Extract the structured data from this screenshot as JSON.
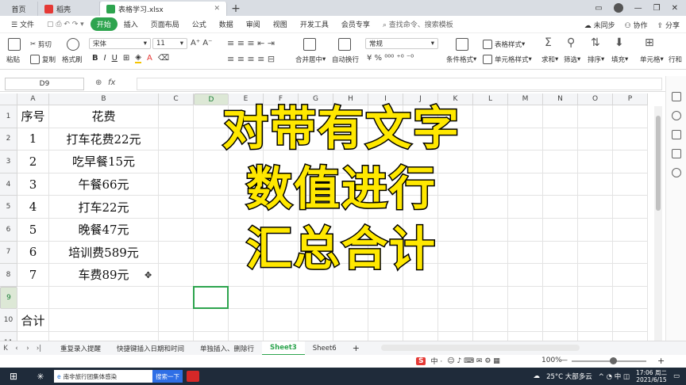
{
  "tabs": {
    "home": "首页",
    "doc": "稻壳",
    "file": "表格学习.xlsx"
  },
  "menubar": {
    "file": "文件",
    "items": [
      "开始",
      "插入",
      "页面布局",
      "公式",
      "数据",
      "审阅",
      "视图",
      "开发工具",
      "会员专享"
    ],
    "search": "查找命令、搜索模板",
    "unsynced": "未同步",
    "collab": "协作",
    "share": "分享"
  },
  "ribbon": {
    "paste": "粘贴",
    "cut": "剪切",
    "copy": "复制",
    "format_painter": "格式刷",
    "font": "宋体",
    "size": "11",
    "number_format": "常规",
    "merge": "合并居中",
    "wrap": "自动换行",
    "cond_format": "条件格式",
    "table_style": "表格样式",
    "cell_style": "单元格样式",
    "sum": "求和",
    "filter": "筛选",
    "sort": "排序",
    "fill": "填充",
    "cell": "单元格",
    "rowcol": "行和"
  },
  "formula_bar": {
    "cell_ref": "D9",
    "fx": "fx",
    "value": ""
  },
  "columns": [
    "A",
    "B",
    "C",
    "D",
    "E",
    "F",
    "G",
    "H",
    "I",
    "J",
    "K",
    "L",
    "M",
    "N",
    "O",
    "P"
  ],
  "rows": [
    {
      "n": "1",
      "a": "序号",
      "b": "花费"
    },
    {
      "n": "2",
      "a": "1",
      "b": "打车花费22元"
    },
    {
      "n": "3",
      "a": "2",
      "b": "吃早餐15元"
    },
    {
      "n": "4",
      "a": "3",
      "b": "午餐66元"
    },
    {
      "n": "5",
      "a": "4",
      "b": "打车22元"
    },
    {
      "n": "6",
      "a": "5",
      "b": "晚餐47元"
    },
    {
      "n": "7",
      "a": "6",
      "b": "培训费589元"
    },
    {
      "n": "8",
      "a": "7",
      "b": "车费89元"
    },
    {
      "n": "9",
      "a": "",
      "b": ""
    },
    {
      "n": "10",
      "a": "合计",
      "b": ""
    },
    {
      "n": "11",
      "a": "",
      "b": ""
    }
  ],
  "overlay_lines": [
    "对带有文字",
    "数值进行",
    "汇总合计"
  ],
  "sheet_tabs": [
    "重复录入提醒",
    "快捷键插入日期和时间",
    "单独插入、删除行",
    "Sheet3",
    "Sheet6"
  ],
  "active_sheet": "Sheet3",
  "status": {
    "zoom": "100%"
  },
  "taskbar": {
    "app": "南非旅行团集体感染",
    "search": "搜索一下",
    "weather": "25°C 大部多云",
    "time": "17:06 周二",
    "date": "2021/6/15"
  },
  "colors": {
    "accent": "#2da44e",
    "overlay_text": "#ffe800"
  }
}
